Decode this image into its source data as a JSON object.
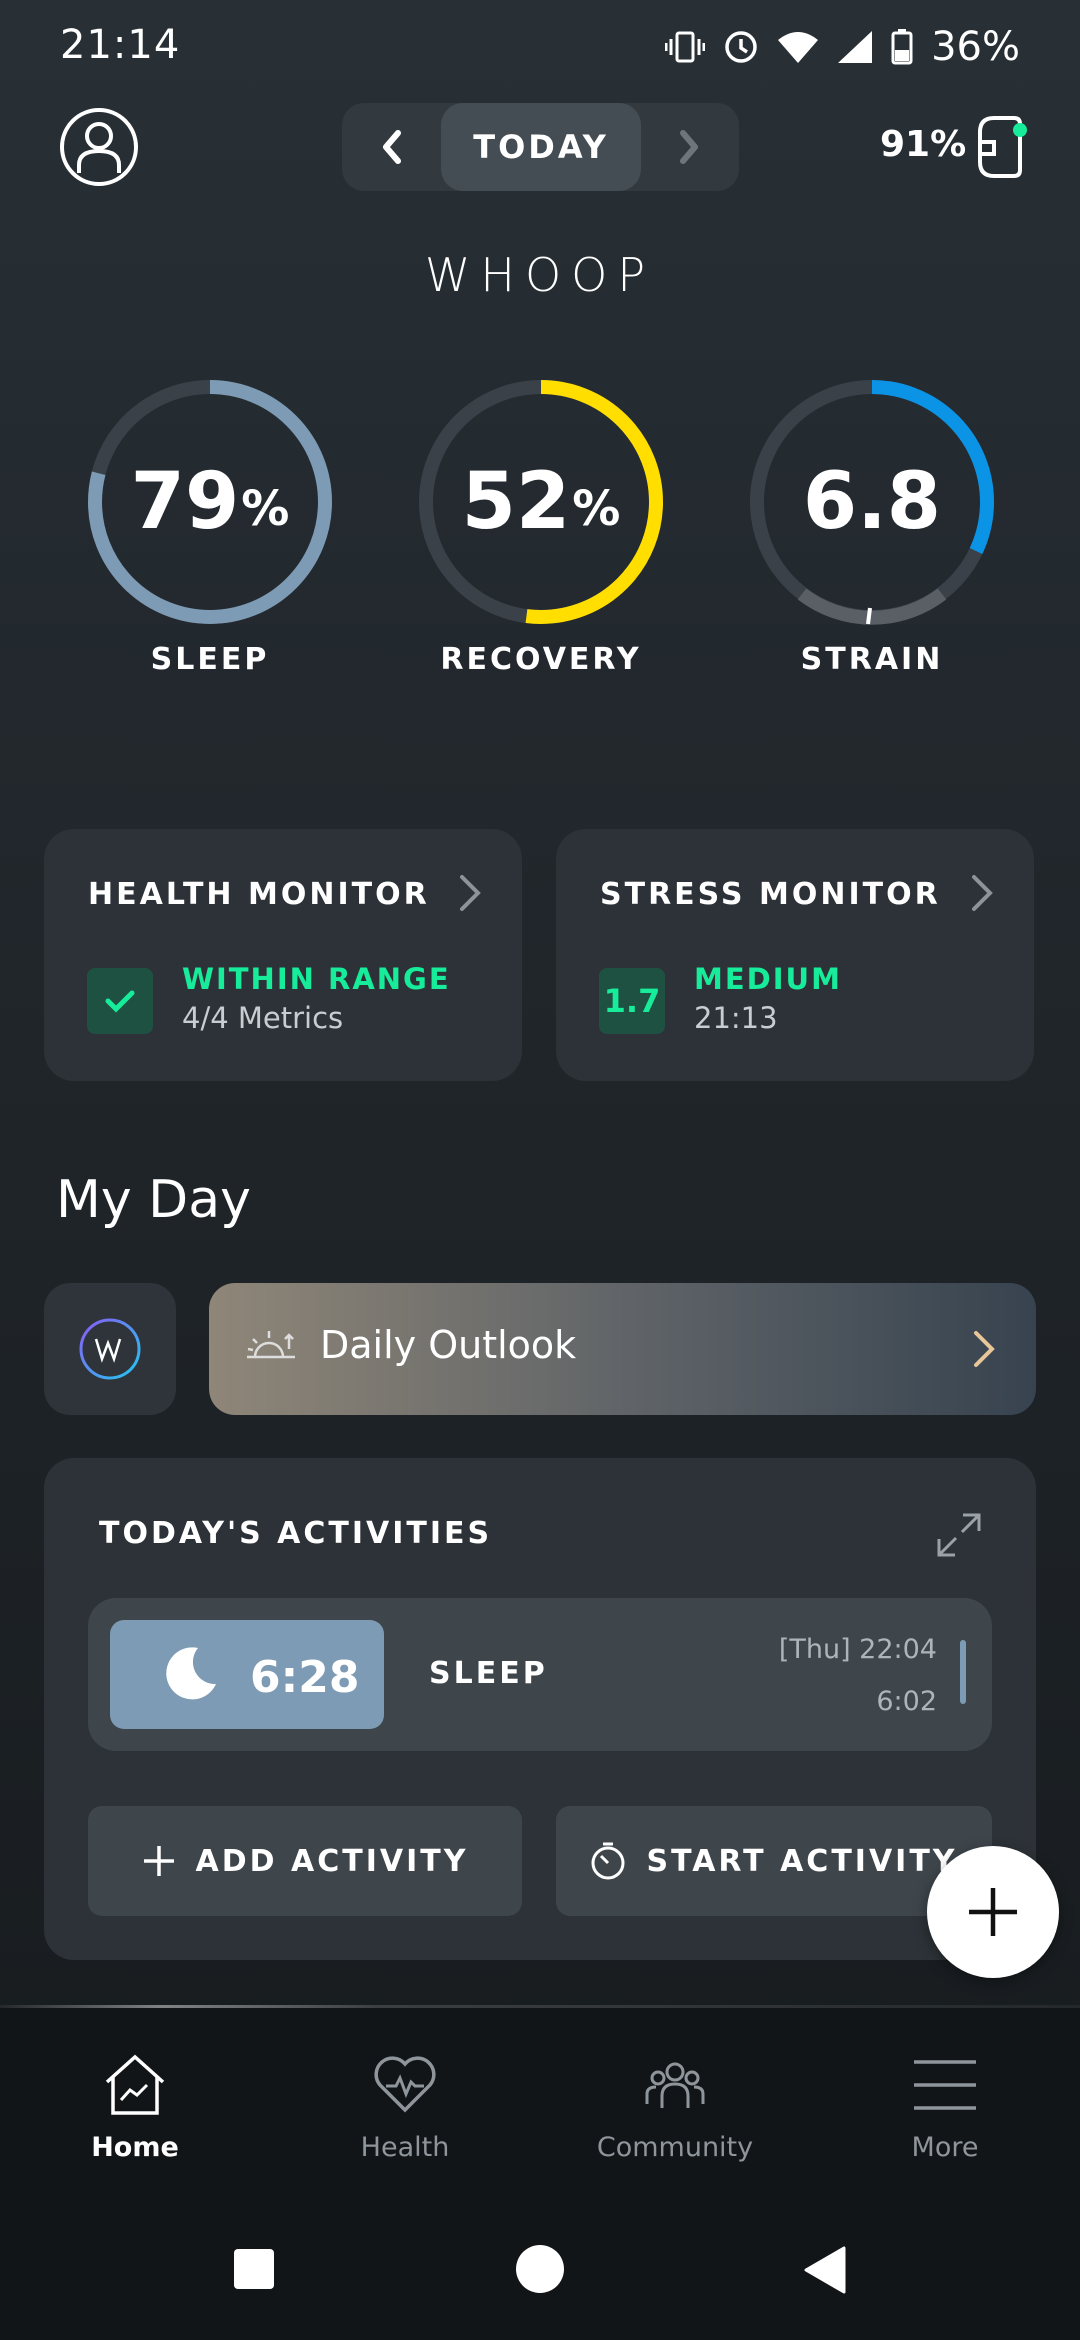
{
  "status_bar": {
    "time": "21:14",
    "battery": "36%"
  },
  "header": {
    "date_label": "TODAY",
    "band_battery": "91%",
    "logo": "WHOOP"
  },
  "rings": [
    {
      "value": "79",
      "unit": "%",
      "label": "SLEEP",
      "progress": 0.79,
      "color": "#7d9bb4"
    },
    {
      "value": "52",
      "unit": "%",
      "label": "RECOVERY",
      "progress": 0.52,
      "color": "#ffde00"
    },
    {
      "value": "6.8",
      "unit": "",
      "label": "STRAIN",
      "progress": 0.32,
      "color": "#0b93e6"
    }
  ],
  "health_monitor": {
    "title": "HEALTH MONITOR",
    "status": "WITHIN RANGE",
    "sub": "4/4 Metrics"
  },
  "stress_monitor": {
    "title": "STRESS MONITOR",
    "score": "1.7",
    "status": "MEDIUM",
    "sub": "21:13"
  },
  "my_day": {
    "title": "My Day",
    "outlook_label": "Daily Outlook"
  },
  "activities": {
    "title": "TODAY'S ACTIVITIES",
    "sleep": {
      "duration": "6:28",
      "label": "SLEEP",
      "start": "[Thu] 22:04",
      "end": "6:02"
    },
    "add_label": "ADD ACTIVITY",
    "start_label": "START ACTIVITY"
  },
  "nav": [
    {
      "label": "Home",
      "active": true
    },
    {
      "label": "Health",
      "active": false
    },
    {
      "label": "Community",
      "active": false
    },
    {
      "label": "More",
      "active": false
    }
  ],
  "colors": {
    "accent_green": "#16ec9a",
    "sleep_blue": "#7d9bb4",
    "recovery_yellow": "#ffde00",
    "strain_blue": "#0b93e6"
  }
}
